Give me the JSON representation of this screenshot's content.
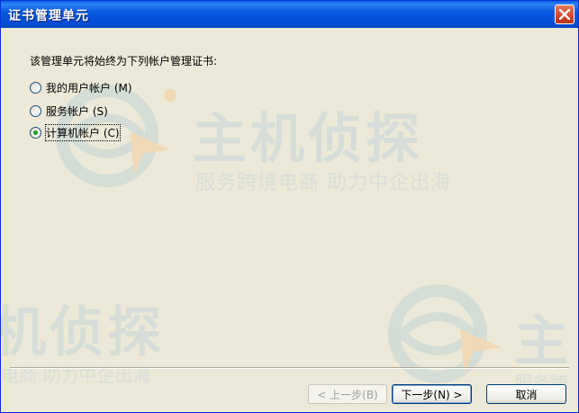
{
  "window": {
    "title": "证书管理单元",
    "close_icon": "close-icon"
  },
  "dialog": {
    "prompt": "该管理单元将始终为下列帐户管理证书:",
    "options": [
      {
        "label": "我的用户帐户 (M)",
        "checked": false
      },
      {
        "label": "服务帐户 (S)",
        "checked": false
      },
      {
        "label": "计算机帐户 (C)",
        "checked": true
      }
    ]
  },
  "buttons": {
    "back": "< 上一步(B)",
    "next": "下一步(N) >",
    "cancel": "取消"
  },
  "watermark": {
    "brand": "主机侦探",
    "tagline": "服务跨境电商 助力中企出海"
  },
  "colors": {
    "title_bar": "#0a5ae0",
    "close_button": "#d2462a",
    "dialog_bg": "#ece9d8",
    "radio_dot": "#21a121"
  }
}
